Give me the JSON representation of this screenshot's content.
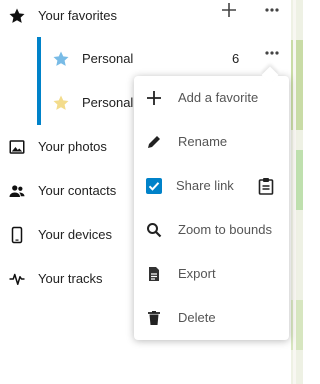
{
  "favorites": {
    "label": "Your favorites",
    "categories": [
      {
        "label": "Personal",
        "count": "6",
        "star_color": "#78bbe6"
      },
      {
        "label": "Personal",
        "star_color": "#f3dc8c"
      }
    ]
  },
  "sections": [
    {
      "label": "Your photos",
      "icon": "image-icon"
    },
    {
      "label": "Your contacts",
      "icon": "contacts-icon"
    },
    {
      "label": "Your devices",
      "icon": "phone-icon"
    },
    {
      "label": "Your tracks",
      "icon": "activity-icon"
    }
  ],
  "context_menu": {
    "add_favorite": "Add a favorite",
    "rename": "Rename",
    "share_link": "Share link",
    "share_checked": true,
    "zoom_to_bounds": "Zoom to bounds",
    "export": "Export",
    "delete": "Delete"
  },
  "colors": {
    "accent": "#0082c9",
    "checkbox": "#0082c9"
  }
}
